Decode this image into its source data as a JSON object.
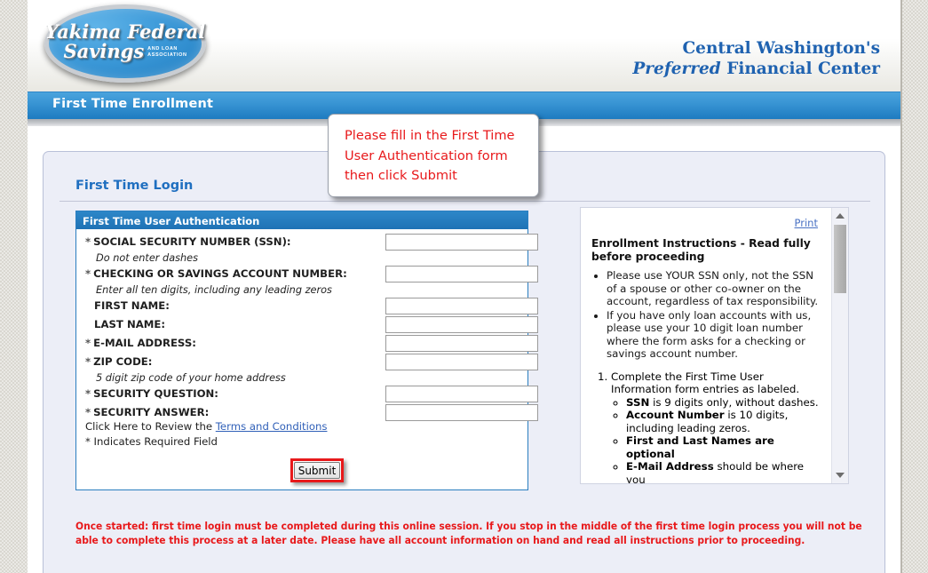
{
  "brand": {
    "logo_line1": "Yakima Federal",
    "logo_line2": "Savings",
    "logo_sub_line1": "AND LOAN",
    "logo_sub_line2": "ASSOCIATION",
    "tagline_line1": "Central Washington's",
    "tagline_preferred": "Preferred",
    "tagline_rest": " Financial Center",
    "accent_blue": "#1f62b0",
    "banner_blue": "#2f86c7"
  },
  "banner": {
    "title": "First Time Enrollment"
  },
  "panel": {
    "title": "First Time Login"
  },
  "tooltip": {
    "text": "Please fill in the First Time User Authentication form then click Submit",
    "text_color": "#e8191b"
  },
  "auth_form": {
    "header": "First Time User Authentication",
    "fields": [
      {
        "label": "SOCIAL SECURITY NUMBER (SSN):",
        "required": true,
        "hint": "Do not enter dashes",
        "value": ""
      },
      {
        "label": "CHECKING OR SAVINGS ACCOUNT NUMBER:",
        "required": true,
        "hint": "Enter all ten digits, including any leading zeros",
        "value": ""
      },
      {
        "label": "FIRST NAME:",
        "required": false,
        "hint": "",
        "value": ""
      },
      {
        "label": "LAST NAME:",
        "required": false,
        "hint": "",
        "value": ""
      },
      {
        "label": "E-MAIL ADDRESS:",
        "required": true,
        "hint": "",
        "value": ""
      },
      {
        "label": "ZIP CODE:",
        "required": true,
        "hint": "5 digit zip code of your home address",
        "value": ""
      },
      {
        "label": "SECURITY QUESTION:",
        "required": true,
        "hint": "",
        "value": ""
      },
      {
        "label": "SECURITY ANSWER:",
        "required": true,
        "hint": "",
        "value": ""
      }
    ],
    "terms_prefix": "Click Here to Review the ",
    "terms_link": "Terms and Conditions",
    "required_note": "* Indicates Required Field",
    "submit_label": "Submit",
    "submit_highlight_color": "#e8191b"
  },
  "instructions": {
    "print_label": "Print",
    "heading": "Enrollment Instructions - Read fully before proceeding",
    "bullets": [
      "Please use YOUR SSN only, not the SSN of a spouse or other co-owner on the account, regardless of tax responsibility.",
      "If you have only loan accounts with us, please use your 10 digit loan number where the form asks for a checking or savings account number."
    ],
    "step_1": "Complete the First Time User Information form entries as labeled.",
    "sub_items": [
      {
        "bold": "SSN",
        "rest": " is 9 digits only, without dashes."
      },
      {
        "bold": "Account Number",
        "rest": " is 10 digits, including leading zeros."
      },
      {
        "bold": "First and Last Names are optional",
        "rest": ""
      },
      {
        "bold": "E-Mail Address",
        "rest": " should be where you"
      }
    ]
  },
  "warning": {
    "text": "Once started: first time login must be completed during this online session. If you stop in the middle of the first time login process you will not be able to complete this process at a later date. Please have all account information on hand and read all instructions prior to proceeding.",
    "color": "#e8191b"
  }
}
